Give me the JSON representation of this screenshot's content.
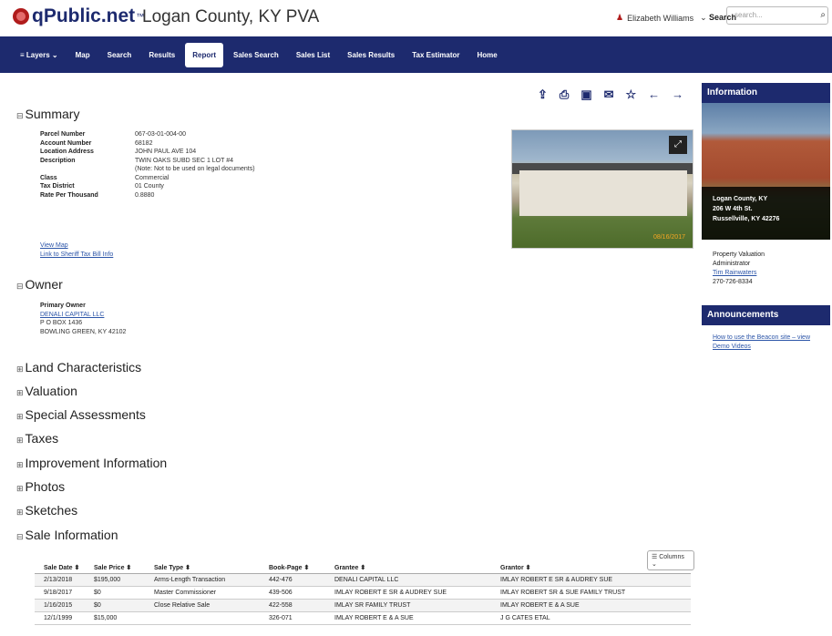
{
  "header": {
    "brand": "qPublic.net",
    "tm": "™",
    "county_title": "Logan County, KY PVA",
    "user_name": "Elizabeth Williams",
    "search_label": "Search",
    "search_placeholder": "search..."
  },
  "nav": {
    "items": [
      "Layers",
      "Map",
      "Search",
      "Results",
      "Report",
      "Sales Search",
      "Sales List",
      "Sales Results",
      "Tax Estimator",
      "Home"
    ],
    "active": "Report"
  },
  "summary": {
    "title": "Summary",
    "fields": [
      {
        "label": "Parcel Number",
        "value": "067-03-01-004-00"
      },
      {
        "label": "Account Number",
        "value": "68182"
      },
      {
        "label": "Location Address",
        "value": "JOHN PAUL AVE 104"
      },
      {
        "label": "Description",
        "value": "TWIN OAKS SUBD SEC 1 LOT #4"
      },
      {
        "label": "",
        "value": "(Note: Not to be used on legal documents)"
      },
      {
        "label": "Class",
        "value": "Commercial"
      },
      {
        "label": "Tax District",
        "value": "01 County"
      },
      {
        "label": "Rate Per Thousand",
        "value": "0.8880"
      }
    ],
    "view_map": "View Map",
    "sheriff_link": "Link to Sheriff Tax Bill Info",
    "photo_date": "08/16/2017"
  },
  "owner": {
    "title": "Owner",
    "primary_label": "Primary Owner",
    "name": "DENALI CAPITAL LLC",
    "address1": "P O BOX 1436",
    "address2": "BOWLING GREEN, KY 42102"
  },
  "collapsed_sections": [
    "Land Characteristics",
    "Valuation",
    "Special Assessments",
    "Taxes",
    "Improvement Information",
    "Photos",
    "Sketches"
  ],
  "sales": {
    "title": "Sale Information",
    "columns_button": "Columns",
    "headers": [
      "Sale Date ⬍",
      "Sale Price ⬍",
      "Sale Type ⬍",
      "Book-Page ⬍",
      "Grantee ⬍",
      "Grantor ⬍"
    ],
    "rows": [
      [
        "2/13/2018",
        "$195,000",
        "Arms-Length Transaction",
        "442-476",
        "DENALI CAPITAL LLC",
        "IMLAY ROBERT E SR & AUDREY SUE"
      ],
      [
        "9/18/2017",
        "$0",
        "Master Commissioner",
        "439-506",
        "IMLAY ROBERT E SR & AUDREY SUE",
        "IMLAY ROBERT SR & SUE FAMILY TRUST"
      ],
      [
        "1/16/2015",
        "$0",
        "Close Relative Sale",
        "422-558",
        "IMLAY SR FAMILY TRUST",
        "IMLAY ROBERT E & A SUE"
      ],
      [
        "12/1/1999",
        "$15,000",
        "",
        "326-071",
        "IMLAY ROBERT E & A SUE",
        "J G CATES ETAL"
      ]
    ]
  },
  "sidebar": {
    "info_title": "Information",
    "caption_lines": [
      "Logan County, KY",
      "206 W 4th St.",
      "Russellville, KY 42276"
    ],
    "pva_lines": [
      "Property Valuation",
      "Administrator"
    ],
    "pva_name": "Tim Rainwaters",
    "pva_phone": "270-726-8334",
    "announcements_title": "Announcements",
    "announcement_link": "How to use the Beacon site – view Demo Videos"
  }
}
